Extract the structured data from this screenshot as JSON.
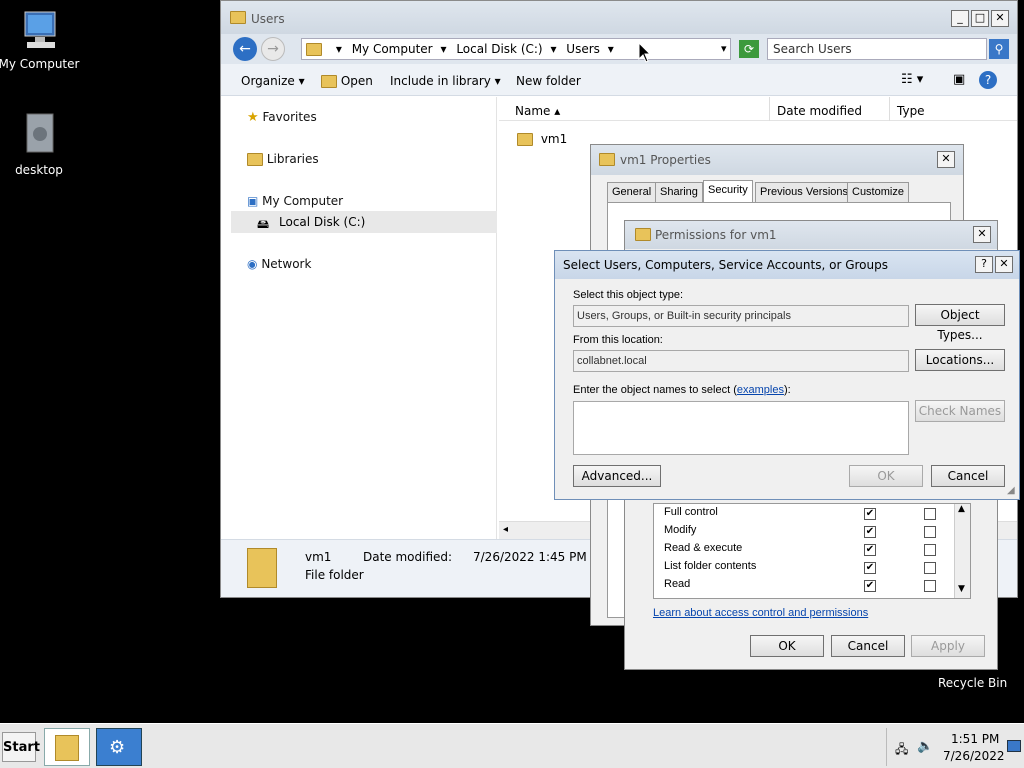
{
  "desktop": {
    "icons": [
      {
        "label": "My Computer"
      },
      {
        "label": "desktop"
      },
      {
        "label": "Recycle Bin"
      }
    ]
  },
  "explorer": {
    "title": "Users",
    "breadcrumb": [
      "My Computer",
      "Local Disk (C:)",
      "Users"
    ],
    "search_placeholder": "Search Users",
    "toolbar": {
      "organize": "Organize",
      "open": "Open",
      "include": "Include in library",
      "new_folder": "New folder"
    },
    "nav": {
      "favorites": "Favorites",
      "libraries": "Libraries",
      "my_computer": "My Computer",
      "local_disk": "Local Disk (C:)",
      "network": "Network"
    },
    "columns": {
      "name": "Name",
      "date": "Date modified",
      "type": "Type"
    },
    "items": [
      {
        "name": "vm1"
      }
    ],
    "details": {
      "name": "vm1",
      "date_label": "Date modified:",
      "date_value": "7/26/2022 1:45 PM",
      "type": "File folder"
    }
  },
  "properties": {
    "title": "vm1 Properties",
    "tabs": [
      "General",
      "Sharing",
      "Security",
      "Previous Versions",
      "Customize"
    ],
    "active_tab": "Security"
  },
  "permissions": {
    "title": "Permissions for vm1",
    "rows": [
      {
        "name": "Full control",
        "allow": true,
        "deny": false
      },
      {
        "name": "Modify",
        "allow": true,
        "deny": false
      },
      {
        "name": "Read & execute",
        "allow": true,
        "deny": false
      },
      {
        "name": "List folder contents",
        "allow": true,
        "deny": false
      },
      {
        "name": "Read",
        "allow": true,
        "deny": false
      }
    ],
    "learn_link": "Learn about access control and permissions",
    "ok": "OK",
    "cancel": "Cancel",
    "apply": "Apply"
  },
  "select_dialog": {
    "title": "Select Users, Computers, Service Accounts, or Groups",
    "object_type_label": "Select this object type:",
    "object_type_value": "Users, Groups, or Built-in security principals",
    "object_types_btn": "Object Types...",
    "location_label": "From this location:",
    "location_value": "collabnet.local",
    "locations_btn": "Locations...",
    "names_label": "Enter the object names to select (",
    "names_link": "examples",
    "names_label_end": "):",
    "check_names_btn": "Check Names",
    "advanced_btn": "Advanced...",
    "ok": "OK",
    "cancel": "Cancel"
  },
  "taskbar": {
    "start": "Start",
    "time": "1:51 PM",
    "date": "7/26/2022"
  }
}
